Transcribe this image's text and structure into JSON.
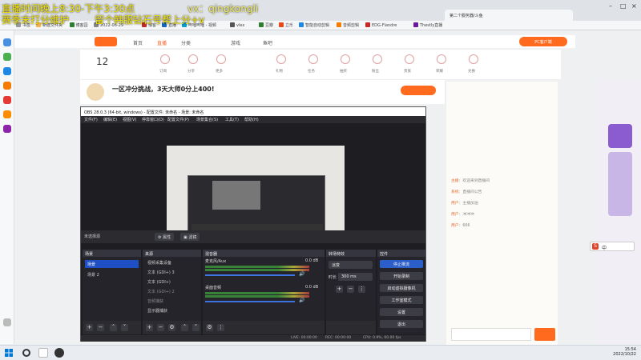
{
  "overlay": {
    "line1": "直播时间晚上8:30-下午3:30点",
    "line2": "赛季末打分维护",
    "line3": "留个韩服钻石号帮上分+v",
    "contact": "vx：qingkongli"
  },
  "browser": {
    "tab_active": "第二个服务器/斗鱼",
    "bookmarks": [
      "书签",
      "新建文件夹",
      "博客园",
      "2022-06-29",
      "博客",
      "直播",
      "哔哩哔哩 - 视频",
      "vlex",
      "豆瓣",
      "立乐",
      "智能自动剪辑",
      "音频剪辑",
      "EDG-Flandre",
      "Thestly直播"
    ]
  },
  "site": {
    "nav": [
      "首页",
      "直播",
      "分类",
      "游戏",
      "鱼吧"
    ],
    "level_badge": "12",
    "pc_button": "PC客户端",
    "stream_title": "一区冲分挑战，3天大师0分上400!",
    "toolbar_labels": [
      "订阅",
      "分享",
      "更多",
      "礼物",
      "任务",
      "抽奖",
      "粉丝",
      "贵族",
      "荣耀",
      "兑换"
    ]
  },
  "chat": {
    "lines": [
      {
        "user": "主播",
        "text": "欢迎来到直播间"
      },
      {
        "user": "系统",
        "text": "直播间公告"
      },
      {
        "user": "用户",
        "text": "主播加油"
      },
      {
        "user": "用户",
        "text": "冲冲冲"
      },
      {
        "user": "用户",
        "text": "666"
      }
    ]
  },
  "obs": {
    "title": "OBS 28.0.3 (64-bit, windows) - 配置文件: 未命名 - 场景: 未命名",
    "menu": [
      "文件(F)",
      "编辑(E)",
      "视图(V)",
      "停靠窗口(D)",
      "配置文件(P)",
      "场景集合(S)",
      "工具(T)",
      "帮助(H)"
    ],
    "no_source_selected": "未选择源",
    "properties_btn": "属性",
    "filters_btn": "滤镜",
    "panels": {
      "scenes": {
        "title": "场景",
        "items": [
          "场景",
          "场景 2"
        ]
      },
      "sources": {
        "title": "来源",
        "items": [
          "视频采集设备",
          "文本 (GDI+) 3",
          "文本 (GDI+)",
          "文本 (GDI+) 2",
          "音频捕获",
          "显示器捕获"
        ]
      },
      "mixer": {
        "title": "混音器",
        "channels": [
          {
            "name": "麦克风/Aux",
            "db": "0.0 dB"
          },
          {
            "name": "桌面音频",
            "db": "0.0 dB"
          }
        ]
      },
      "transitions": {
        "title": "转场特效",
        "type": "淡变",
        "duration_label": "时长",
        "duration": "300 ms"
      },
      "controls": {
        "title": "控件",
        "buttons": [
          "停止推流",
          "开始录制",
          "启动虚拟摄像机",
          "工作室模式",
          "设置",
          "退出"
        ]
      }
    },
    "status": {
      "live": "LIVE: 00:00:00",
      "rec": "REC: 00:00:00",
      "cpu": "CPU: 0.9%, 60.00 fps"
    }
  },
  "ime": {
    "label": "中"
  },
  "taskbar": {
    "time": "15:54",
    "date": "2022/10/22"
  }
}
